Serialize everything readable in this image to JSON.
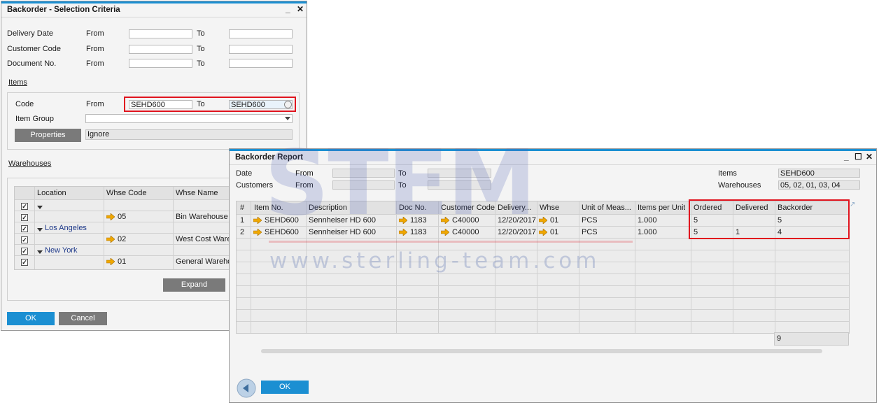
{
  "criteria": {
    "title": "Backorder - Selection Criteria",
    "rows": [
      {
        "label": "Delivery Date",
        "from": "From",
        "to": "To",
        "from_value": "",
        "to_value": ""
      },
      {
        "label": "Customer Code",
        "from": "From",
        "to": "To",
        "from_value": "",
        "to_value": ""
      },
      {
        "label": "Document No.",
        "from": "From",
        "to": "To",
        "from_value": "",
        "to_value": ""
      }
    ],
    "items_header": "Items",
    "code_label": "Code",
    "code_from_label": "From",
    "code_to_label": "To",
    "code_from_value": "SEHD600",
    "code_to_value": "SEHD600",
    "item_group_label": "Item Group",
    "item_group_value": "",
    "properties_label": "Properties",
    "properties_value": "Ignore",
    "warehouses_header": "Warehouses",
    "wh_columns": [
      "Location",
      "Whse Code",
      "Whse Name"
    ],
    "wh_rows": [
      {
        "checked": true,
        "location": "",
        "expand": true,
        "code": "",
        "name": ""
      },
      {
        "checked": true,
        "location": "",
        "expand": false,
        "code": "05",
        "name": "Bin Warehouse"
      },
      {
        "checked": true,
        "location": "Los Angeles",
        "expand": true,
        "code": "",
        "name": ""
      },
      {
        "checked": true,
        "location": "",
        "expand": false,
        "code": "02",
        "name": "West Cost Ware"
      },
      {
        "checked": true,
        "location": "New York",
        "expand": true,
        "code": "",
        "name": ""
      },
      {
        "checked": true,
        "location": "",
        "expand": false,
        "code": "01",
        "name": "General Warehou"
      }
    ],
    "expand_label": "Expand",
    "ok_label": "OK",
    "cancel_label": "Cancel"
  },
  "report": {
    "title": "Backorder Report",
    "date_label": "Date",
    "customers_label": "Customers",
    "from_label": "From",
    "to_label": "To",
    "items_label": "Items",
    "items_value": "SEHD600",
    "warehouses_label": "Warehouses",
    "warehouses_value": "05, 02, 01, 03, 04",
    "columns": [
      "#",
      "Item No.",
      "Description",
      "Doc No.",
      "Customer Code",
      "Delivery...",
      "Whse",
      "Unit of Meas...",
      "Items per Unit",
      "Ordered",
      "Delivered",
      "Backorder"
    ],
    "rows": [
      {
        "num": "1",
        "item": "SEHD600",
        "desc": "Sennheiser HD 600",
        "doc": "1183",
        "cust": "C40000",
        "delivery": "12/20/2017",
        "whse": "01",
        "uom": "PCS",
        "ipu": "1.000",
        "ordered": "5",
        "delivered": "",
        "backorder": "5"
      },
      {
        "num": "2",
        "item": "SEHD600",
        "desc": "Sennheiser HD 600",
        "doc": "1183",
        "cust": "C40000",
        "delivery": "12/20/2017",
        "whse": "01",
        "uom": "PCS",
        "ipu": "1.000",
        "ordered": "5",
        "delivered": "1",
        "backorder": "4"
      }
    ],
    "total_backorder": "9",
    "ok_label": "OK"
  },
  "watermark": "www.sterling-team.com",
  "watermark_logo": "STEM",
  "colors": {
    "accent": "#1b8fd2",
    "highlight": "#e0141e",
    "arrow": "#f0a800"
  }
}
